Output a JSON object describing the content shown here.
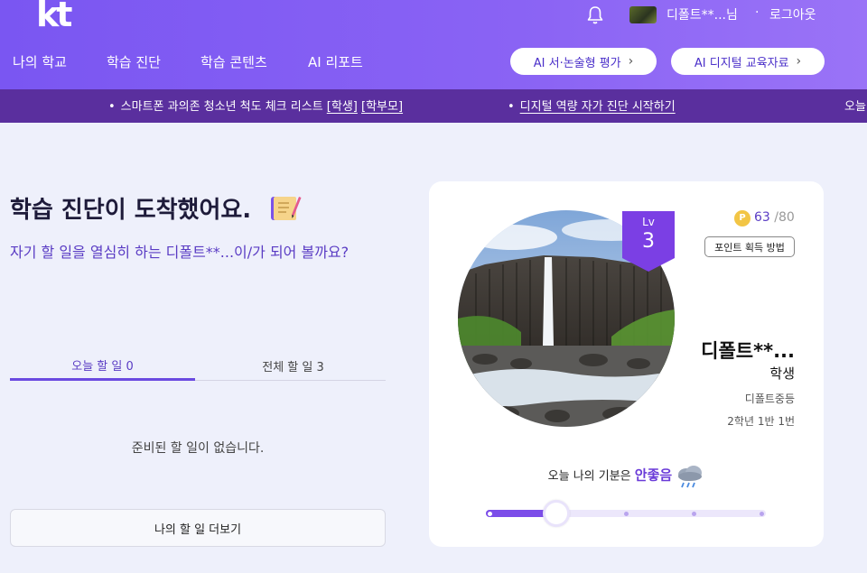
{
  "header": {
    "logo": "kt",
    "user": {
      "name": "디폴트**...님",
      "separator": "·",
      "logout": "로그아웃"
    },
    "nav": [
      "나의 학교",
      "학습 진단",
      "학습 콘텐츠",
      "AI 리포트"
    ],
    "buttons": [
      {
        "label": "AI 서·논술형 평가",
        "chevron": "›"
      },
      {
        "label": "AI 디지털 교육자료",
        "chevron": "›"
      }
    ]
  },
  "ticker": {
    "items": [
      {
        "text": "스마트폰 과의존 청소년 척도 체크 리스트",
        "links": [
          "[학생]",
          "[학부모]"
        ]
      },
      {
        "text": "디지털 역량 자가 진단 시작하기"
      },
      {
        "text": "오늘"
      }
    ]
  },
  "main": {
    "title": "학습 진단이 도착했어요.",
    "subtitle": "자기 할 일을 열심히 하는 디폴트**...이/가 되어 볼까요?",
    "tabs": [
      {
        "label": "오늘 할 일 0",
        "active": true
      },
      {
        "label": "전체 할 일 3",
        "active": false
      }
    ],
    "empty_message": "준비된 할 일이 없습니다.",
    "more_button": "나의 할 일 더보기"
  },
  "profile": {
    "level_label": "Lv",
    "level": "3",
    "coin_symbol": "P",
    "points": "63",
    "points_max": "/80",
    "points_button": "포인트 획득 방법",
    "name": "디폴트**...",
    "role": "학생",
    "school": "디폴트중등",
    "class": "2학년 1반 1번",
    "mood_prefix": "오늘 나의 기분은",
    "mood": "안좋음",
    "mood_icon": "rain-cloud-icon",
    "mood_level": 0.25,
    "mood_steps": 5
  },
  "colors": {
    "header_start": "#7a56f2",
    "ticker_bg": "#5a2f9e",
    "accent": "#5a3cc4",
    "page_bg": "#eef0fb"
  }
}
